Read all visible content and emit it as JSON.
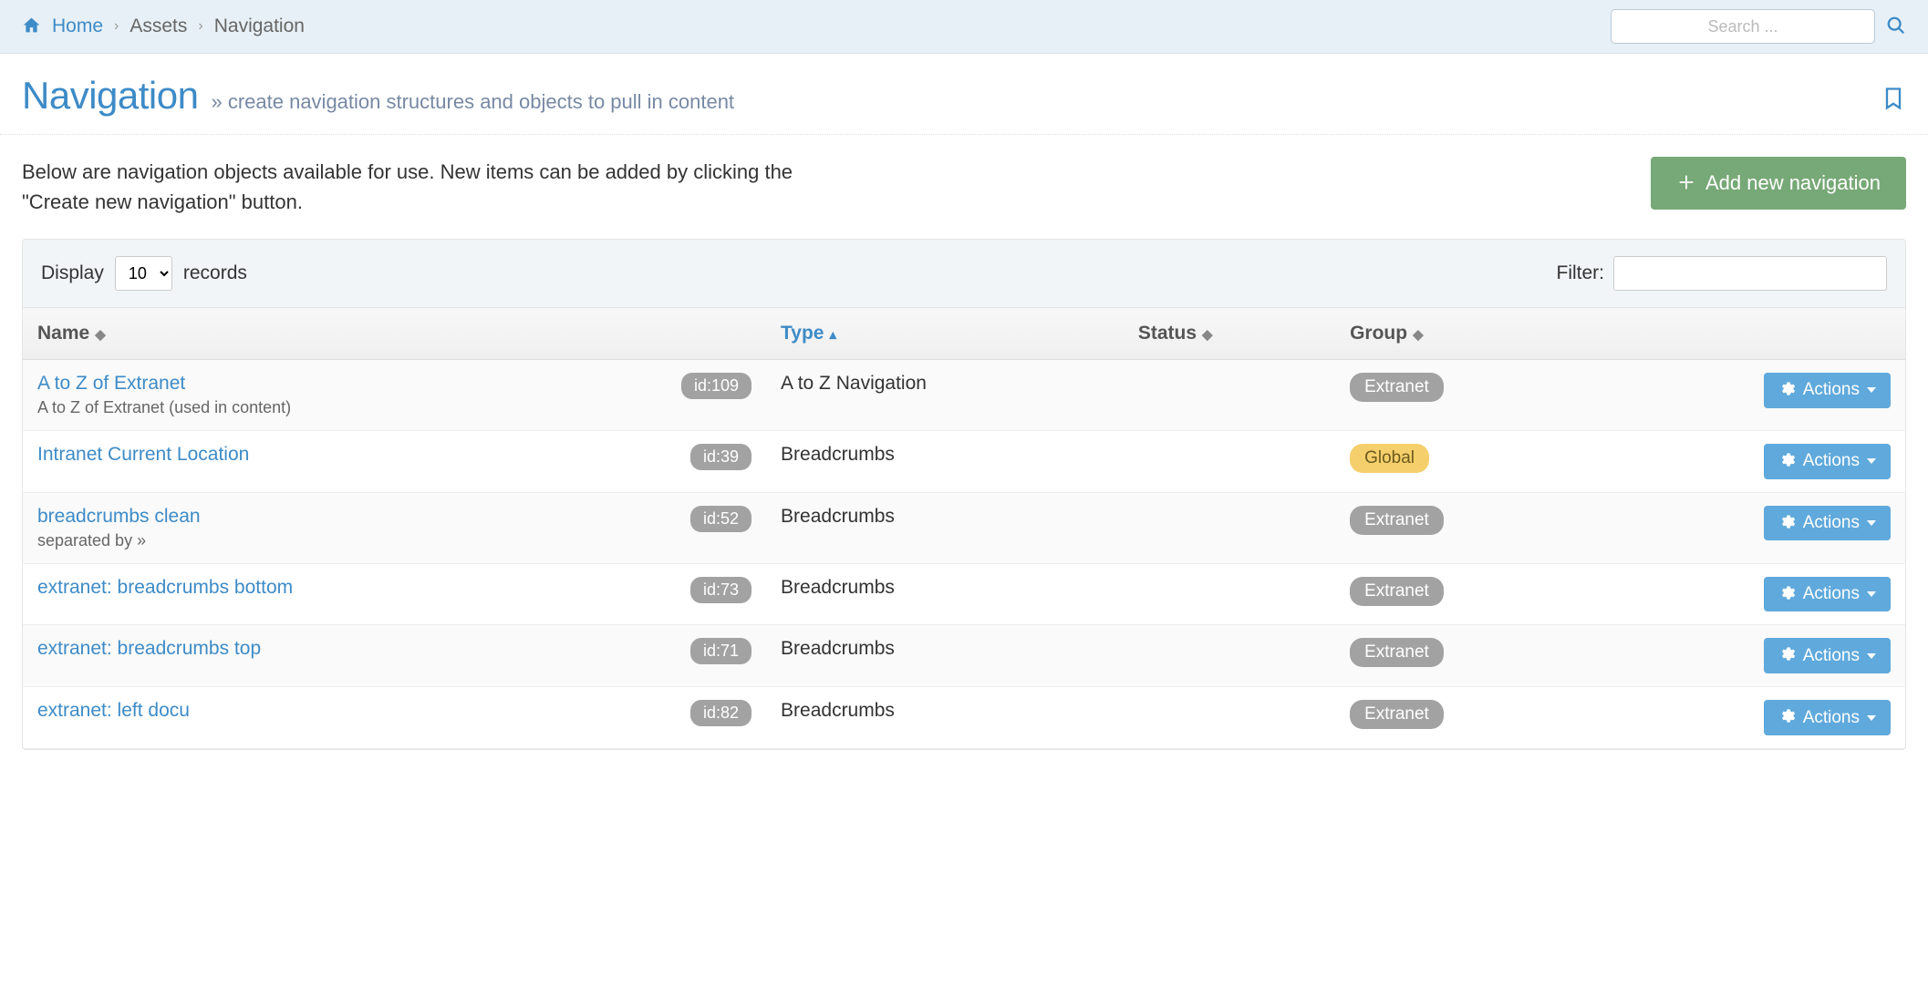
{
  "breadcrumb": {
    "home": "Home",
    "assets": "Assets",
    "current": "Navigation"
  },
  "search": {
    "placeholder": "Search ..."
  },
  "page": {
    "title": "Navigation",
    "subtitle": "create navigation structures and objects to pull in content",
    "intro": "Below are navigation objects available for use. New items can be added by clicking the \"Create new navigation\" button.",
    "add_button": "Add new navigation"
  },
  "controls": {
    "display_label": "Display",
    "records_label": "records",
    "display_value": "10",
    "filter_label": "Filter:"
  },
  "columns": {
    "name": "Name",
    "type": "Type",
    "status": "Status",
    "group": "Group"
  },
  "actions_label": "Actions",
  "rows": [
    {
      "name": "A to Z of Extranet",
      "sub": "A to Z of Extranet (used in content)",
      "id": "id:109",
      "type": "A to Z Navigation",
      "status": "",
      "group": "Extranet",
      "group_style": "default"
    },
    {
      "name": "Intranet Current Location",
      "sub": "",
      "id": "id:39",
      "type": "Breadcrumbs",
      "status": "",
      "group": "Global",
      "group_style": "global"
    },
    {
      "name": "breadcrumbs clean",
      "sub": "separated by &raquo;",
      "id": "id:52",
      "type": "Breadcrumbs",
      "status": "",
      "group": "Extranet",
      "group_style": "default"
    },
    {
      "name": "extranet: breadcrumbs bottom",
      "sub": "",
      "id": "id:73",
      "type": "Breadcrumbs",
      "status": "",
      "group": "Extranet",
      "group_style": "default"
    },
    {
      "name": "extranet: breadcrumbs top",
      "sub": "",
      "id": "id:71",
      "type": "Breadcrumbs",
      "status": "",
      "group": "Extranet",
      "group_style": "default"
    },
    {
      "name": "extranet: left docu",
      "sub": "",
      "id": "id:82",
      "type": "Breadcrumbs",
      "status": "",
      "group": "Extranet",
      "group_style": "default"
    }
  ]
}
